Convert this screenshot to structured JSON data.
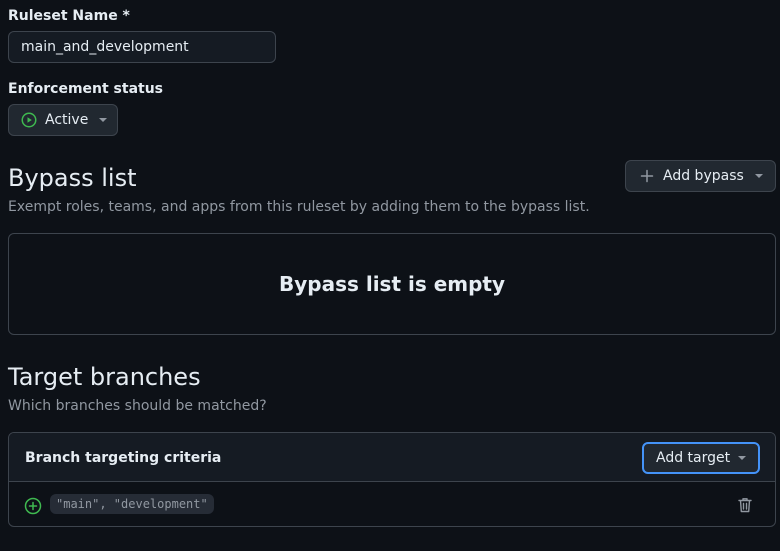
{
  "ruleset": {
    "name_label": "Ruleset Name *",
    "name_value": "main_and_development"
  },
  "enforcement": {
    "label": "Enforcement status",
    "value": "Active",
    "icon": "play-circle-icon",
    "status_color": "#3fb950"
  },
  "bypass": {
    "title": "Bypass list",
    "description": "Exempt roles, teams, and apps from this ruleset by adding them to the bypass list.",
    "add_button_label": "Add bypass",
    "empty_text": "Bypass list is empty"
  },
  "targets": {
    "title": "Target branches",
    "description": "Which branches should be matched?",
    "criteria_label": "Branch targeting criteria",
    "add_button_label": "Add target",
    "focus_color": "#4493f8",
    "items": [
      {
        "pattern": "\"main\", \"development\"",
        "icon": "plus-circle-icon",
        "delete_icon": "trash-icon"
      }
    ]
  }
}
